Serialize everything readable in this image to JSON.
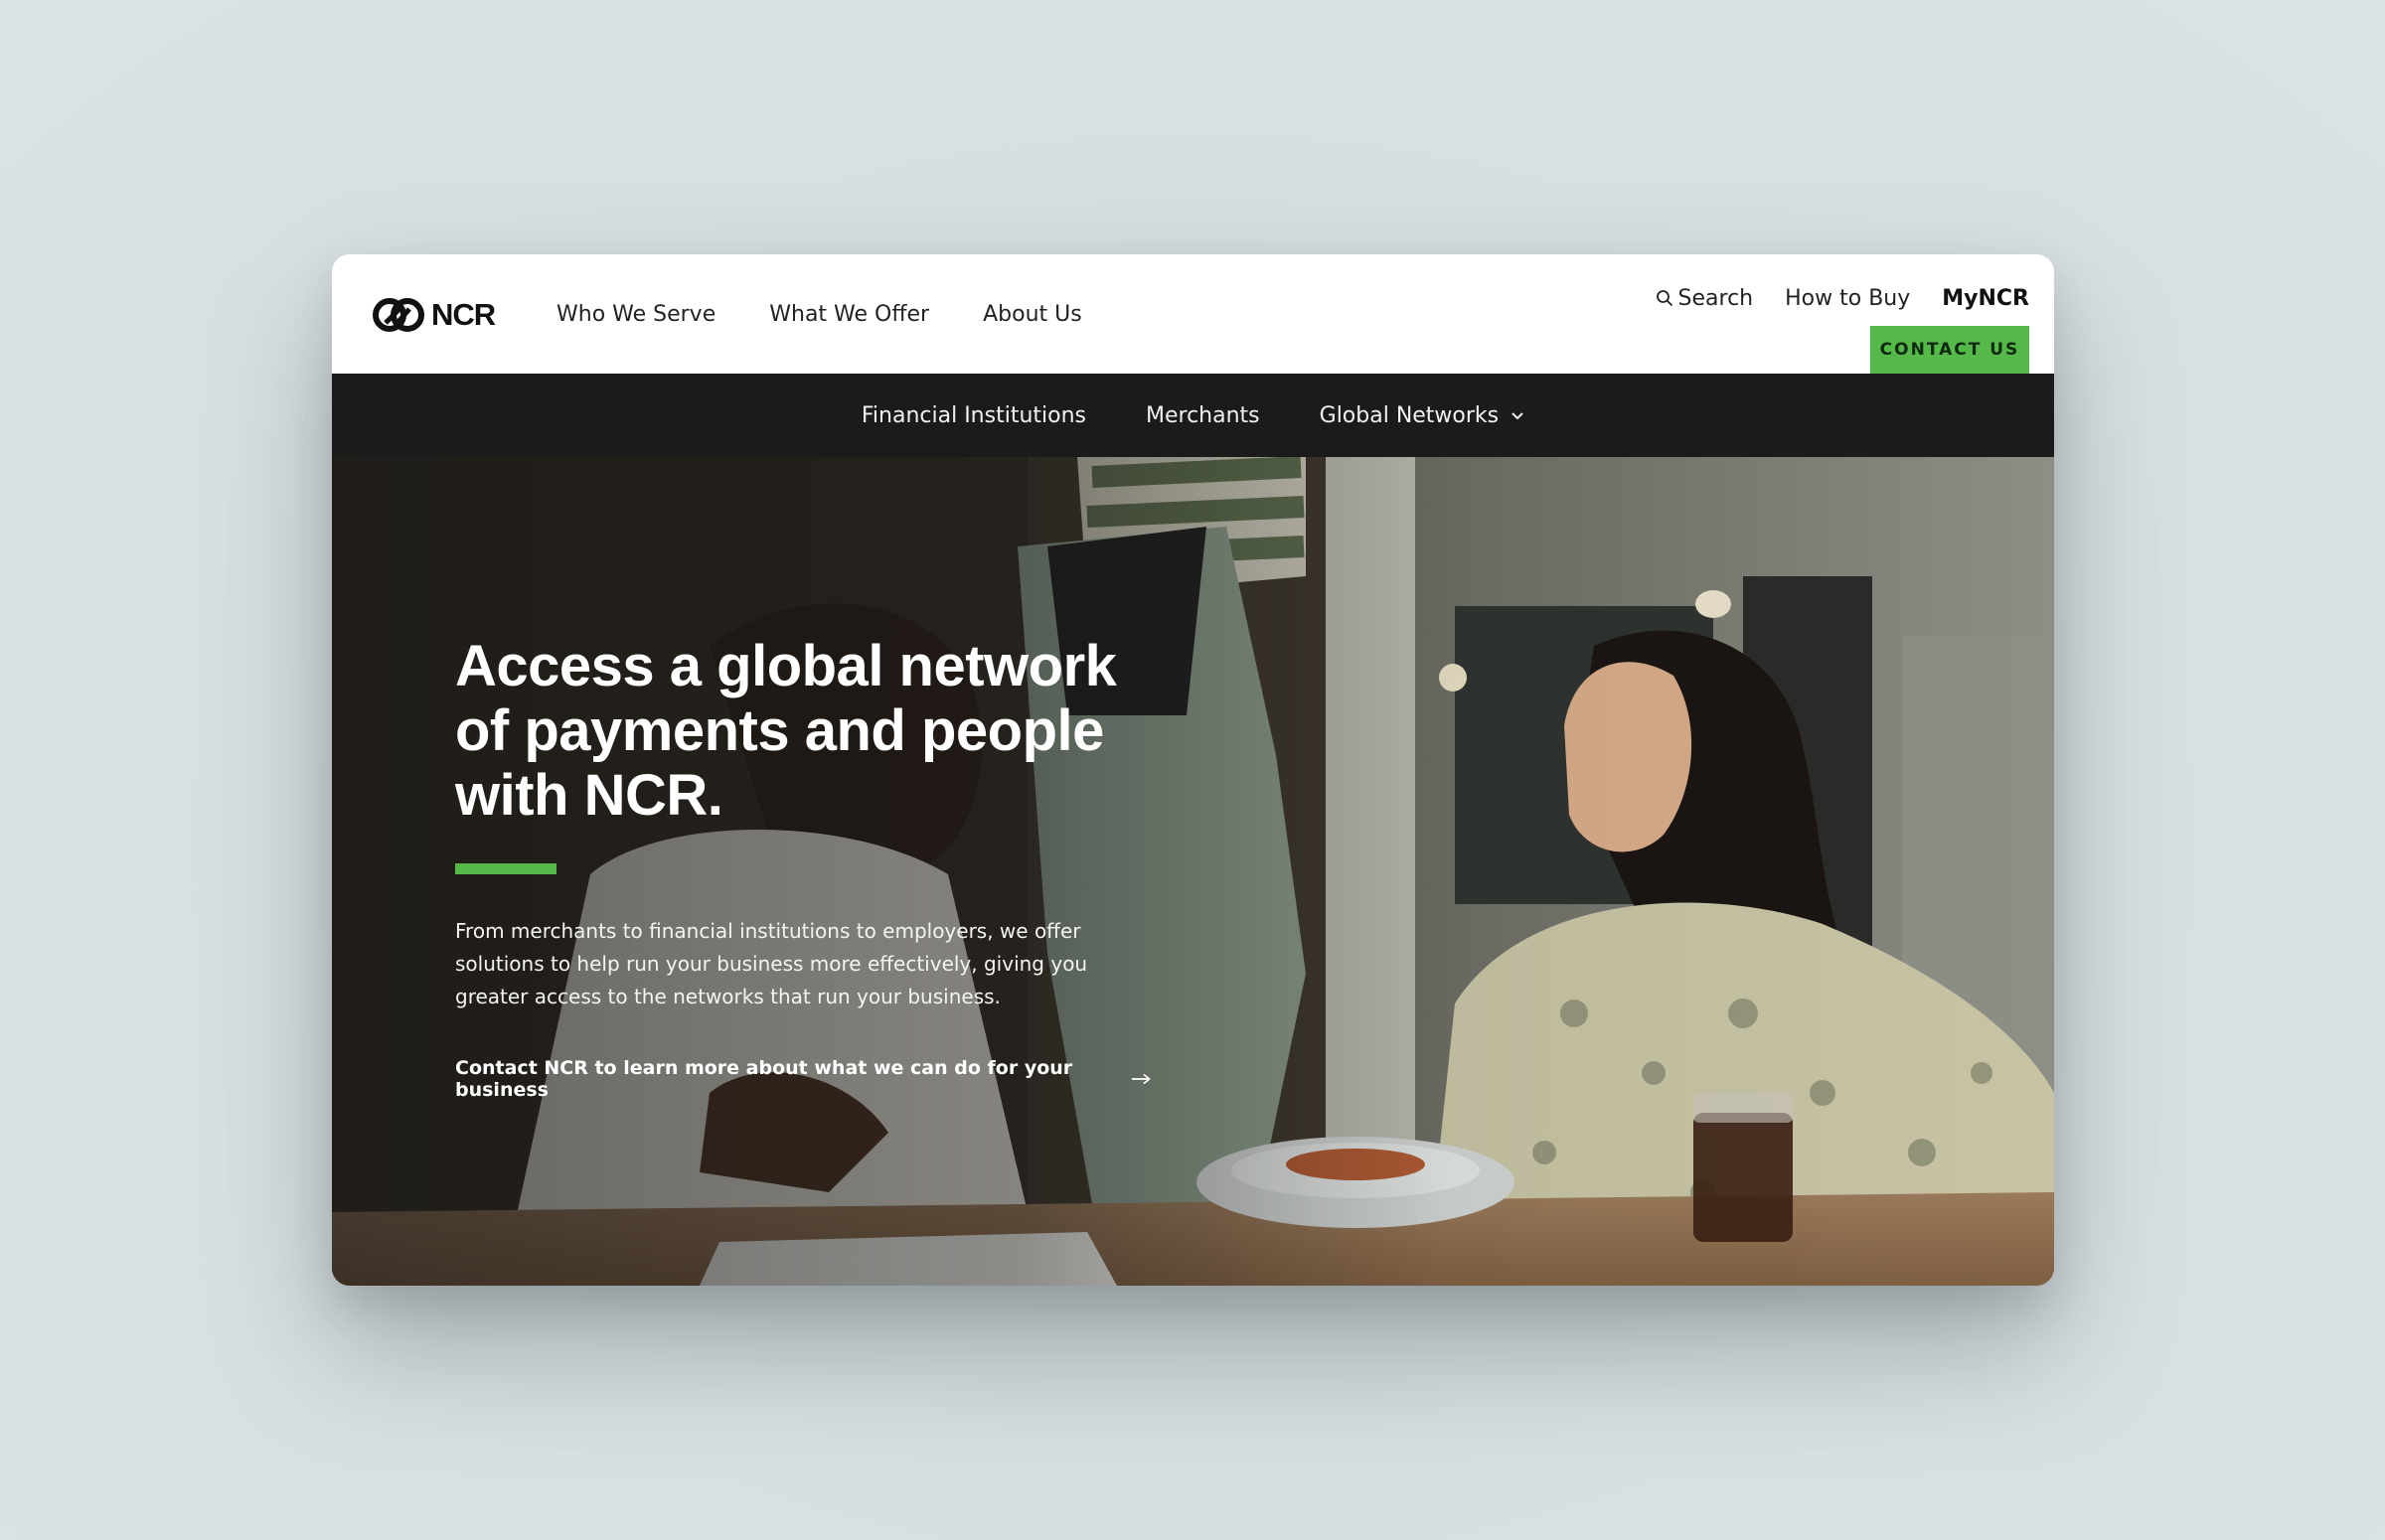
{
  "brand": {
    "name": "NCR",
    "logo_icon": "ncr-interlocked-rings-icon"
  },
  "main_nav": [
    "Who We Serve",
    "What We Offer",
    "About Us"
  ],
  "utility_nav": {
    "search": "Search",
    "how_to_buy": "How to Buy",
    "myncr": "MyNCR",
    "contact": "CONTACT US"
  },
  "sub_nav": [
    "Financial Institutions",
    "Merchants",
    "Global Networks"
  ],
  "hero": {
    "title": "Access a global network of payments and people with NCR.",
    "description": "From merchants to financial institutions to employers, we offer solutions to help run your business more effectively, giving you greater access to the networks that run your business.",
    "cta": "Contact NCR to learn more about what we can do for your business"
  },
  "colors": {
    "accent": "#54b948",
    "subnav_bg": "#1b1b1b",
    "page_bg": "#d5dddf"
  }
}
